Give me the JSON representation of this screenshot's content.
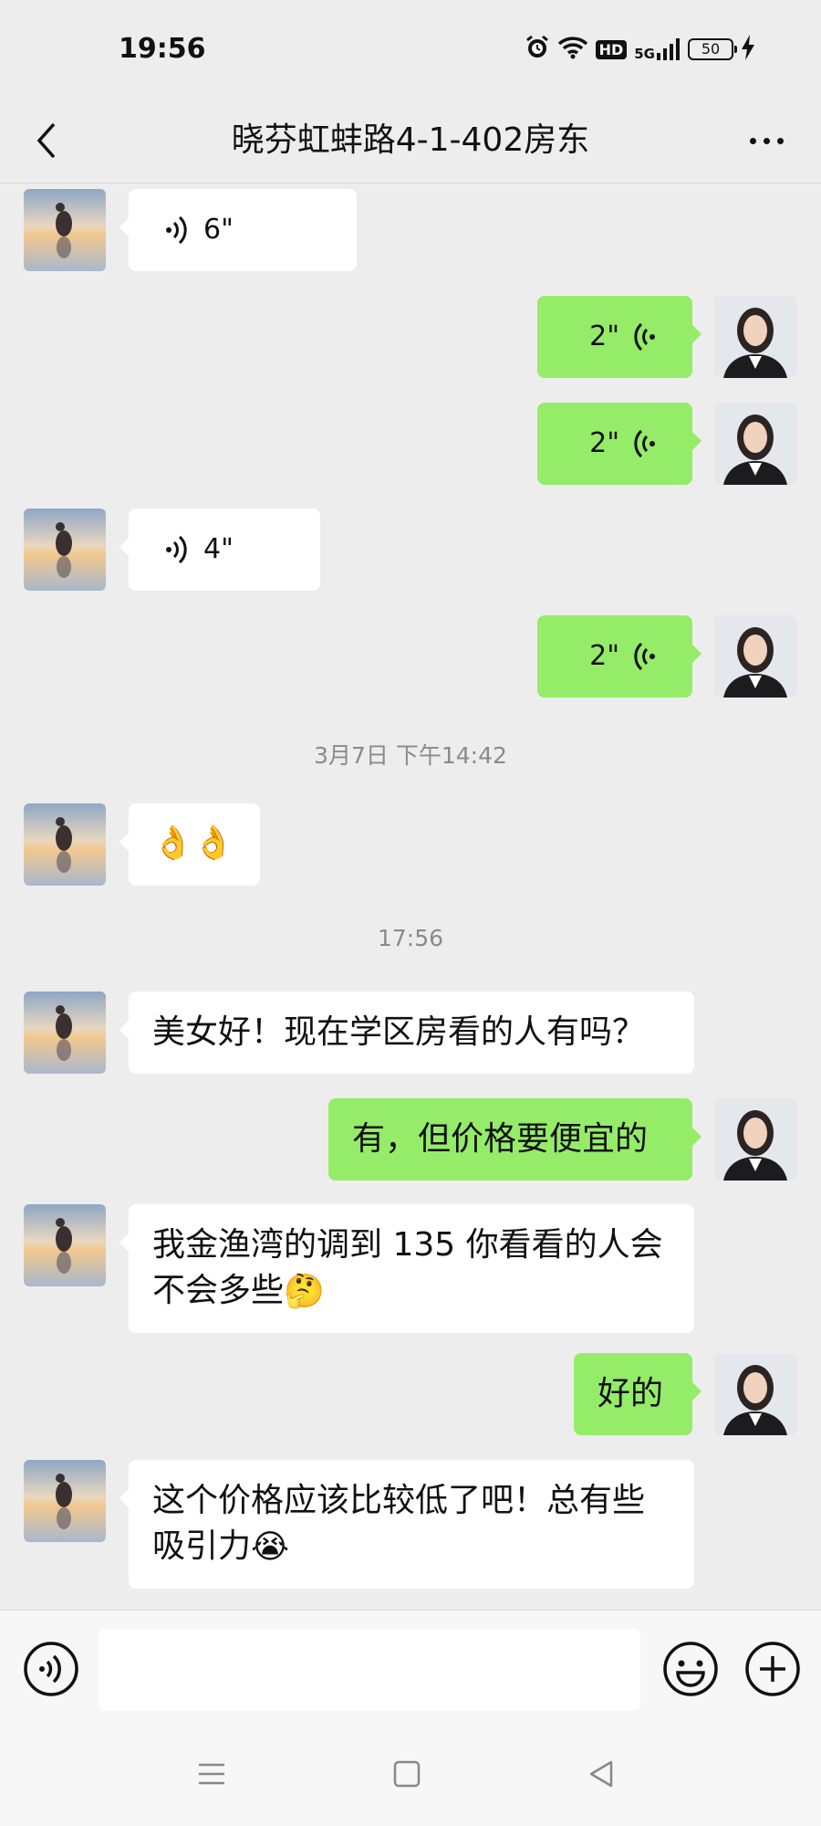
{
  "status_bar": {
    "time": "19:56",
    "network": "5G",
    "hd_label": "HD",
    "battery": "50"
  },
  "header": {
    "title": "晓芬虹蚌路4-1-402房东"
  },
  "messages": [
    {
      "from": "landlord",
      "type": "voice",
      "duration": "6\""
    },
    {
      "from": "me",
      "type": "voice",
      "duration": "2\""
    },
    {
      "from": "me",
      "type": "voice",
      "duration": "2\""
    },
    {
      "from": "landlord",
      "type": "voice",
      "duration": "4\""
    },
    {
      "from": "me",
      "type": "voice",
      "duration": "2\""
    },
    {
      "type": "timestamp",
      "text": "3月7日 下午14:42"
    },
    {
      "from": "landlord",
      "type": "emoji",
      "emoji": "👌👌"
    },
    {
      "type": "timestamp",
      "text": "17:56"
    },
    {
      "from": "landlord",
      "type": "text",
      "text": "美女好！现在学区房看的人有吗？"
    },
    {
      "from": "me",
      "type": "text",
      "text": "有，但价格要便宜的"
    },
    {
      "from": "landlord",
      "type": "text",
      "text": "我金渔湾的调到 135 你看看的人会不会多些",
      "emoji": "🤔"
    },
    {
      "from": "me",
      "type": "text",
      "text": "好的"
    },
    {
      "from": "landlord",
      "type": "text",
      "text": "这个价格应该比较低了吧！总有些吸引力",
      "emoji": "😭"
    }
  ],
  "input": {
    "value": "",
    "placeholder": ""
  },
  "colors": {
    "background": "#ededed",
    "bubble_out": "#95ec69",
    "bubble_in": "#ffffff",
    "timestamp": "#8a8a8a"
  },
  "icons": [
    "back-arrow-icon",
    "more-icon",
    "voice-icon",
    "emoji-icon",
    "plus-icon",
    "menu-icon",
    "home-icon",
    "back-triangle-icon",
    "alarm-icon",
    "wifi-icon",
    "signal-icon",
    "battery-icon",
    "charging-icon"
  ]
}
